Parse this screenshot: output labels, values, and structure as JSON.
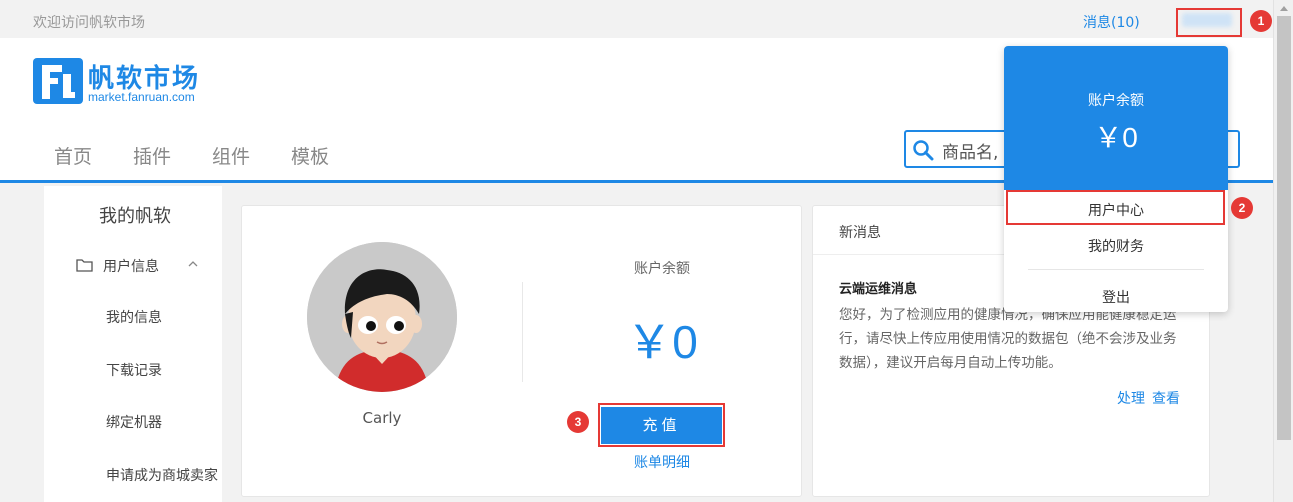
{
  "topbar": {
    "welcome": "欢迎访问帆软市场",
    "messages": "消息(10)"
  },
  "logo": {
    "title": "帆软市场",
    "subtitle": "market.fanruan.com"
  },
  "nav": {
    "items": [
      "首页",
      "插件",
      "组件",
      "模板"
    ]
  },
  "search": {
    "value": "商品名,",
    "placeholder": "商品名称"
  },
  "sidebar": {
    "title": "我的帆软",
    "group": "用户信息",
    "items": [
      "我的信息",
      "下载记录",
      "绑定机器",
      "申请成为商城卖家"
    ]
  },
  "account": {
    "user_name": "Carly",
    "balance_label": "账户余额",
    "balance_value": "￥0",
    "recharge_label": "充值",
    "bill_link": "账单明细"
  },
  "news": {
    "title": "新消息",
    "heading": "云端运维消息",
    "body": "您好，为了检测应用的健康情况，确保应用能健康稳定运行，请尽快上传应用使用情况的数据包（绝不会涉及业务数据），建议开启每月自动上传功能。",
    "action_handle": "处理",
    "action_view": "查看"
  },
  "dropdown": {
    "balance_label": "账户余额",
    "balance_value": "￥0",
    "items": [
      "用户中心",
      "我的财务",
      "登出"
    ]
  },
  "badges": [
    "1",
    "2",
    "3"
  ],
  "colors": {
    "accent": "#1e88e5",
    "highlight": "#e53935"
  }
}
